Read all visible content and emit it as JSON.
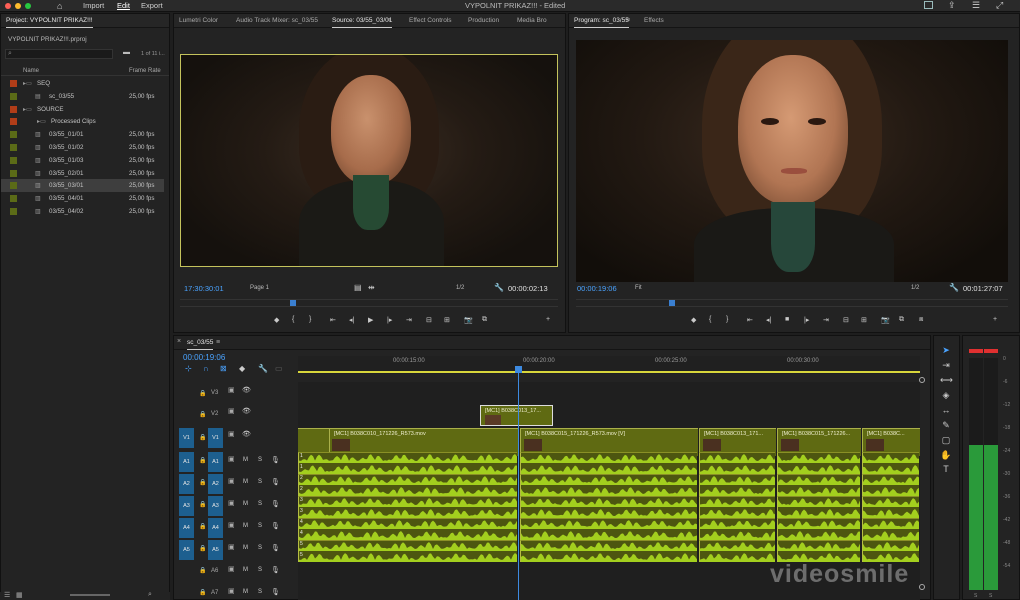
{
  "app": {
    "title": "VYPOLNIT PRIKAZ!!! - Edited",
    "menu": [
      "Import",
      "Edit",
      "Export"
    ],
    "active_menu": "Edit"
  },
  "project": {
    "tab_label": "Project: VYPOLNIT PRIKAZ!!!",
    "file_name": "VYPOLNIT PRIKAZ!!!.prproj",
    "item_count": "1 of 11 i...",
    "col_name": "Name",
    "col_framerate": "Frame Rate",
    "items": [
      {
        "name": "SEQ",
        "type": "bin",
        "rate": "",
        "color": "#b13d18"
      },
      {
        "name": "sc_03/55",
        "type": "sequence",
        "rate": "25,00 fps",
        "color": "#5b6b17"
      },
      {
        "name": "SOURCE",
        "type": "bin",
        "rate": "",
        "color": "#b13d18"
      },
      {
        "name": "Processed Clips",
        "type": "bin",
        "rate": "",
        "color": "#b13d18"
      },
      {
        "name": "03/55_01/01",
        "type": "clip",
        "rate": "25,00 fps",
        "color": "#5b6b17"
      },
      {
        "name": "03/55_01/02",
        "type": "clip",
        "rate": "25,00 fps",
        "color": "#5b6b17"
      },
      {
        "name": "03/55_01/03",
        "type": "clip",
        "rate": "25,00 fps",
        "color": "#5b6b17"
      },
      {
        "name": "03/55_02/01",
        "type": "clip",
        "rate": "25,00 fps",
        "color": "#5b6b17"
      },
      {
        "name": "03/55_03/01",
        "type": "clip",
        "rate": "25,00 fps",
        "color": "#5b6b17",
        "selected": true
      },
      {
        "name": "03/55_04/01",
        "type": "clip",
        "rate": "25,00 fps",
        "color": "#5b6b17"
      },
      {
        "name": "03/55_04/02",
        "type": "clip",
        "rate": "25,00 fps",
        "color": "#5b6b17"
      }
    ]
  },
  "source_tabs": [
    "Lumetri Color",
    "Audio Track Mixer: sc_03/55",
    "Source: 03/55_03/01",
    "Effect Controls",
    "Production",
    "Media Bro"
  ],
  "source": {
    "timecode": "17:30:30:01",
    "page": "Page 1",
    "resolution": "1/2",
    "duration": "00:00:02:13"
  },
  "program_tabs": [
    "Program: sc_03/55",
    "Effects"
  ],
  "program": {
    "timecode": "00:00:19:06",
    "fit": "Fit",
    "resolution": "1/2",
    "duration": "00:01:27:07"
  },
  "timeline": {
    "tab_label": "sc_03/55",
    "timecode": "00:00:19:06",
    "ruler": [
      "00:00:15:00",
      "00:00:20:00",
      "00:00:25:00",
      "00:00:30:00"
    ],
    "video_tracks": [
      "V3",
      "V2",
      "V1"
    ],
    "audio_tracks": [
      "A1",
      "A2",
      "A3",
      "A4",
      "A5",
      "A6",
      "A7"
    ],
    "track_buttons": {
      "mute": "M",
      "solo": "S"
    },
    "clips": [
      {
        "name": "[MC1] B038C013_17...",
        "track": "V2"
      },
      {
        "name": "[MC1] B038C010_171226_R573.mov",
        "track": "V1"
      },
      {
        "name": "[MC1] B038C015_171226_R573.mov [V]",
        "track": "V1"
      },
      {
        "name": "[MC1] B038C013_171...",
        "track": "V1"
      },
      {
        "name": "[MC1] B038C015_171226...",
        "track": "V1"
      },
      {
        "name": "[MC1] B038C...",
        "track": "V1"
      }
    ],
    "audio_channel_nums": [
      "1",
      "1",
      "2",
      "2",
      "3",
      "3",
      "4",
      "4",
      "5",
      "5"
    ]
  },
  "meters": {
    "scale": [
      "0",
      "-6",
      "-12",
      "-18",
      "-24",
      "-30",
      "-36",
      "-42",
      "-48",
      "-54"
    ],
    "bottom": [
      "S",
      "S"
    ],
    "level_fraction": 0.26
  },
  "watermark": "videosmile",
  "icons": [
    "home-icon",
    "share-icon",
    "fullscreen-icon",
    "search-icon",
    "new-bin-icon",
    "play-icon",
    "wrench-icon",
    "camera-icon",
    "selection-tool-icon",
    "razor-tool-icon",
    "pen-tool-icon",
    "hand-tool-icon",
    "type-tool-icon"
  ]
}
